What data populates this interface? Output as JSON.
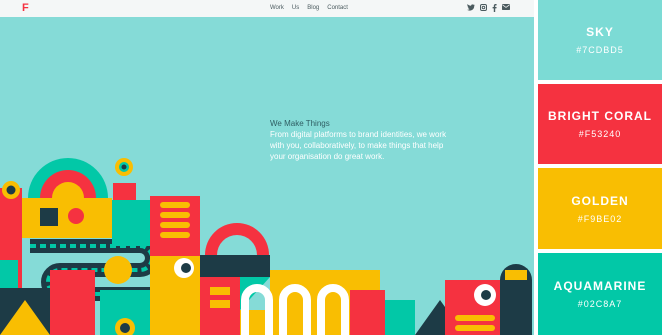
{
  "site": {
    "logo": "F",
    "nav": [
      "Work",
      "Us",
      "Blog",
      "Contact"
    ],
    "social_icons": [
      "twitter-icon",
      "instagram-icon",
      "facebook-icon",
      "email-icon"
    ],
    "hero": {
      "title": "We Make Things",
      "body": "From digital platforms to brand identities, we work with you, collaboratively, to make things that help your organisation do great work."
    },
    "colors": {
      "background": "#85DBD7",
      "topbar": "#F4F7F7"
    }
  },
  "palette": [
    {
      "name": "SKY",
      "hex": "#7CDBD5",
      "color": "#7CDBD5"
    },
    {
      "name": "BRIGHT CORAL",
      "hex": "#F53240",
      "color": "#F53240"
    },
    {
      "name": "GOLDEN",
      "hex": "#F9BE02",
      "color": "#F9BE02"
    },
    {
      "name": "AQUAMARINE",
      "hex": "#02C8A7",
      "color": "#02C8A7"
    }
  ]
}
